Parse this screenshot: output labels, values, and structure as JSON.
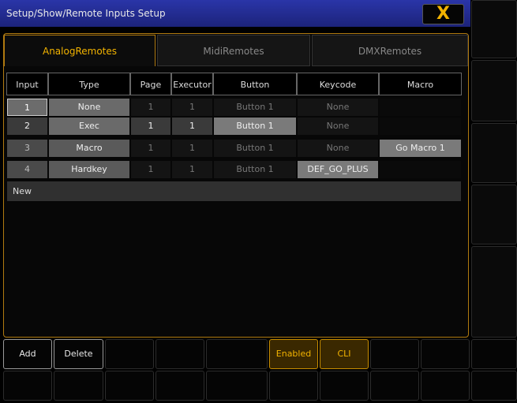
{
  "window": {
    "title": "Setup/Show/Remote Inputs Setup",
    "close_label": "X"
  },
  "tabs": [
    {
      "label": "AnalogRemotes",
      "active": true
    },
    {
      "label": "MidiRemotes",
      "active": false
    },
    {
      "label": "DMXRemotes",
      "active": false
    }
  ],
  "table": {
    "headers": [
      "Input",
      "Type",
      "Page",
      "Executor",
      "Button",
      "Keycode",
      "Macro"
    ],
    "rows": [
      {
        "input": "1",
        "type": "None",
        "page": "1",
        "executor": "1",
        "button": "Button 1",
        "keycode": "None",
        "macro": ""
      },
      {
        "input": "2",
        "type": "Exec",
        "page": "1",
        "executor": "1",
        "button": "Button 1",
        "keycode": "None",
        "macro": ""
      },
      {
        "input": "3",
        "type": "Macro",
        "page": "1",
        "executor": "1",
        "button": "Button 1",
        "keycode": "None",
        "macro": "Go Macro 1"
      },
      {
        "input": "4",
        "type": "Hardkey",
        "page": "1",
        "executor": "1",
        "button": "Button 1",
        "keycode": "DEF_GO_PLUS",
        "macro": ""
      }
    ],
    "new_label": "New"
  },
  "toolbar": {
    "add_label": "Add",
    "delete_label": "Delete",
    "enabled_label": "Enabled",
    "cli_label": "CLI"
  },
  "colors": {
    "accent": "#f2b300",
    "titlebar": "#1c237a"
  }
}
